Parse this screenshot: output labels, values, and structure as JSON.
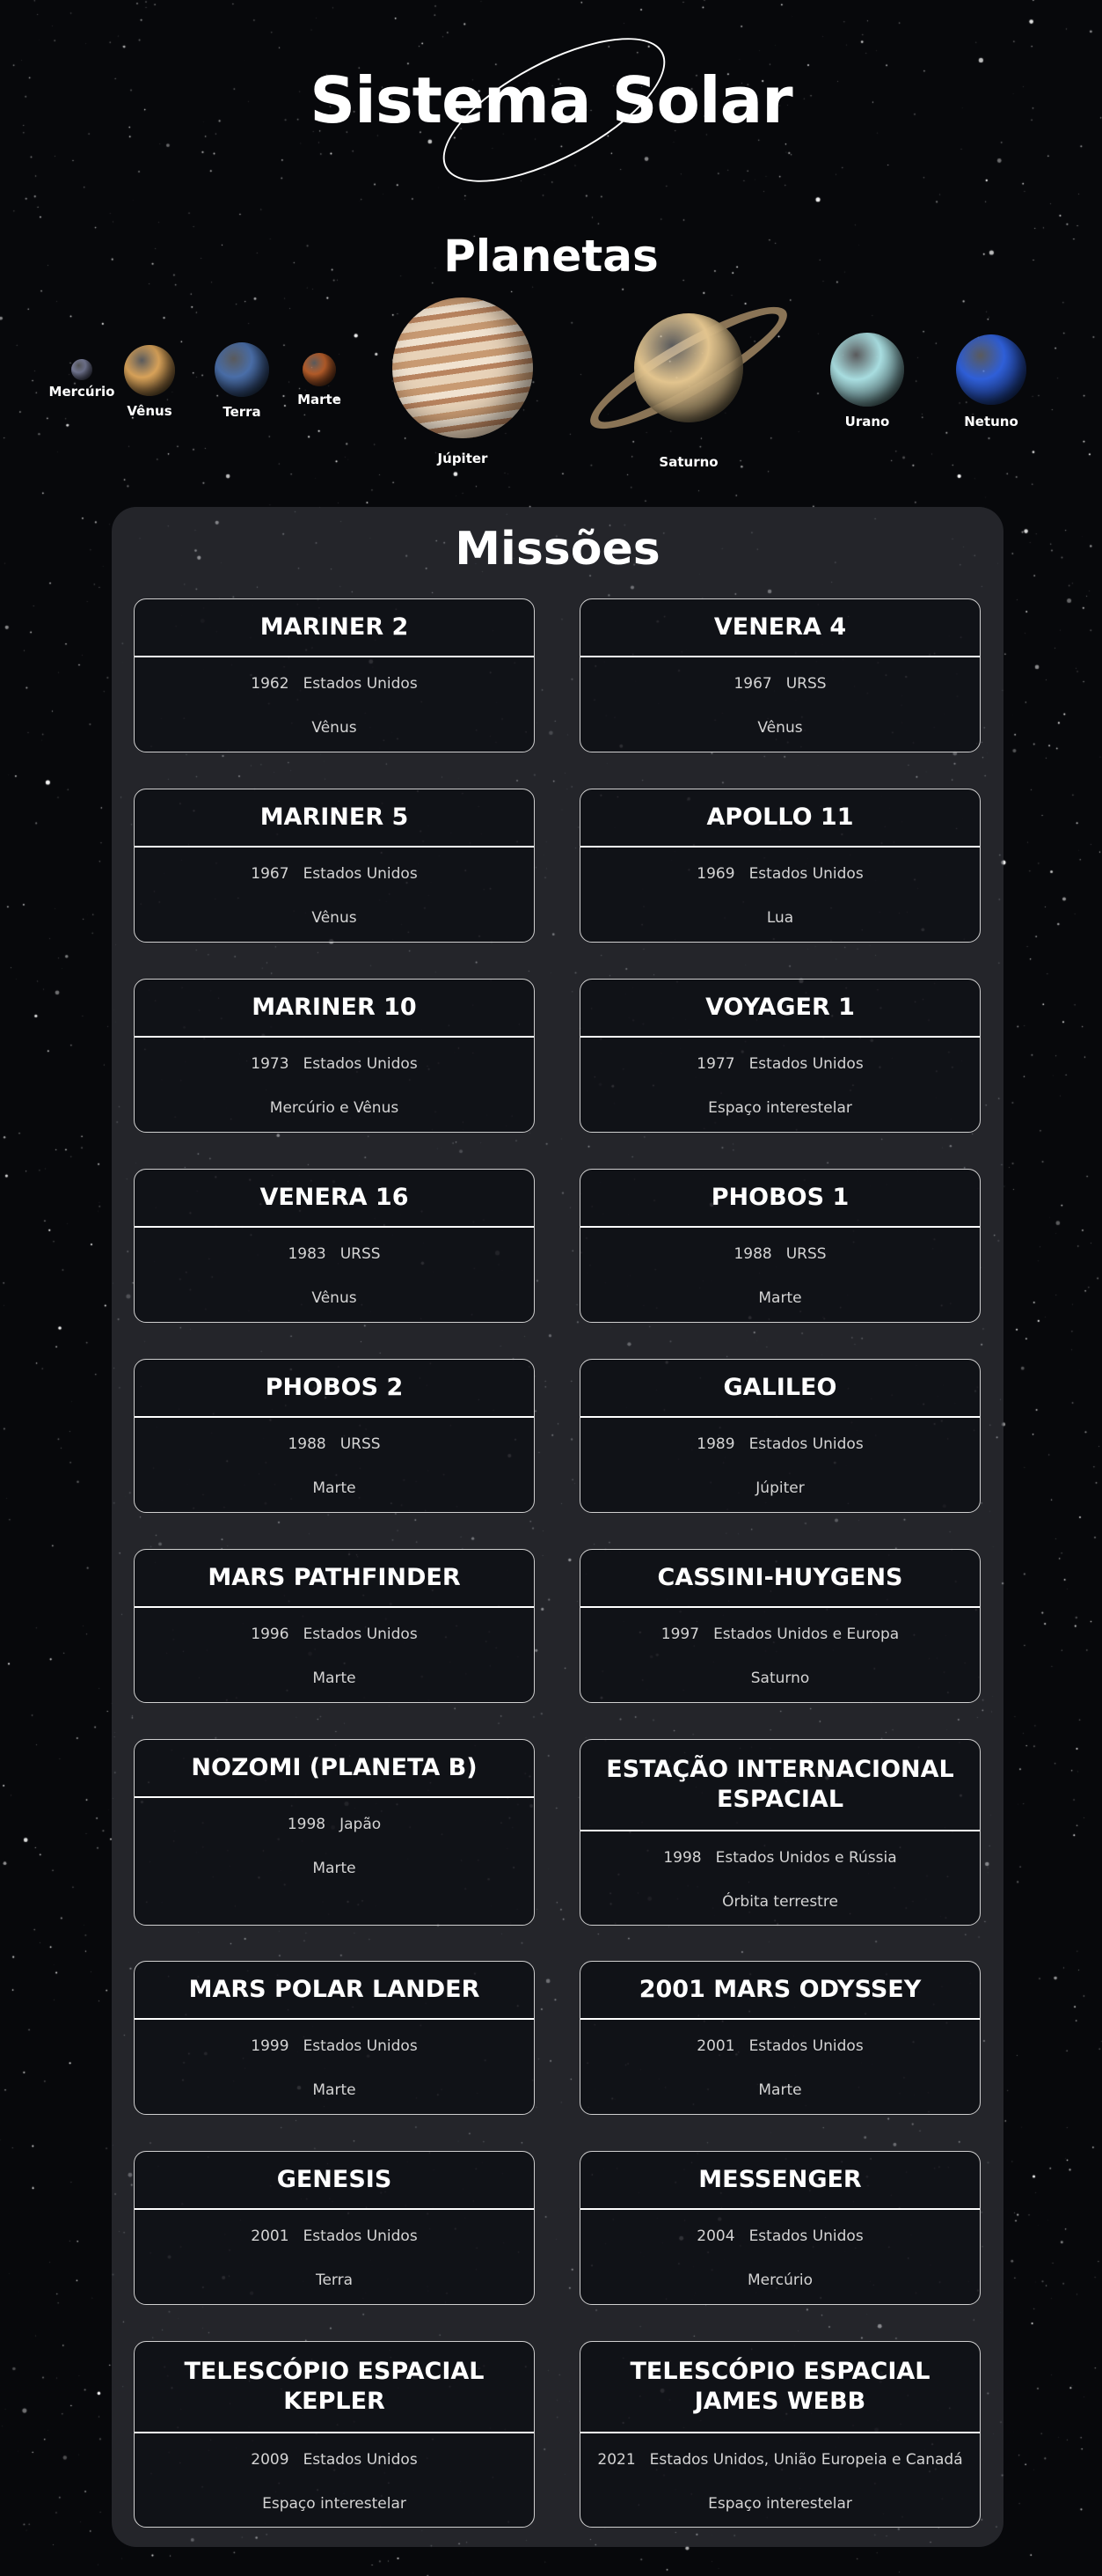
{
  "site_title": "Sistema Solar",
  "planets_title": "Planetas",
  "planets": [
    {
      "name": "Mercúrio",
      "color": "#8a8fb0"
    },
    {
      "name": "Vênus",
      "color": "#d9a35a"
    },
    {
      "name": "Terra",
      "color": "#4a6ea8"
    },
    {
      "name": "Marte",
      "color": "#c0622c"
    },
    {
      "name": "Júpiter",
      "color": "#d9b896"
    },
    {
      "name": "Saturno",
      "color": "#e2c48e"
    },
    {
      "name": "Urano",
      "color": "#a8dde0"
    },
    {
      "name": "Netuno",
      "color": "#2f5fd8"
    }
  ],
  "missions_title": "Missões",
  "missions": [
    {
      "name": "MARINER 2",
      "year": "1962",
      "country": "Estados Unidos",
      "target": "Vênus"
    },
    {
      "name": "VENERA 4",
      "year": "1967",
      "country": "URSS",
      "target": "Vênus"
    },
    {
      "name": "MARINER 5",
      "year": "1967",
      "country": "Estados Unidos",
      "target": "Vênus"
    },
    {
      "name": "APOLLO 11",
      "year": "1969",
      "country": "Estados Unidos",
      "target": "Lua"
    },
    {
      "name": "MARINER 10",
      "year": "1973",
      "country": "Estados Unidos",
      "target": "Mercúrio e Vênus"
    },
    {
      "name": "VOYAGER 1",
      "year": "1977",
      "country": "Estados Unidos",
      "target": "Espaço interestelar"
    },
    {
      "name": "VENERA 16",
      "year": "1983",
      "country": "URSS",
      "target": "Vênus"
    },
    {
      "name": "PHOBOS 1",
      "year": "1988",
      "country": "URSS",
      "target": "Marte"
    },
    {
      "name": "PHOBOS 2",
      "year": "1988",
      "country": "URSS",
      "target": "Marte"
    },
    {
      "name": "GALILEO",
      "year": "1989",
      "country": "Estados Unidos",
      "target": "Júpiter"
    },
    {
      "name": "MARS PATHFINDER",
      "year": "1996",
      "country": "Estados Unidos",
      "target": "Marte"
    },
    {
      "name": "CASSINI-HUYGENS",
      "year": "1997",
      "country": "Estados Unidos e Europa",
      "target": "Saturno"
    },
    {
      "name": "NOZOMI (PLANETA B)",
      "year": "1998",
      "country": "Japão",
      "target": "Marte"
    },
    {
      "name": "ESTAÇÃO INTERNACIONAL ESPACIAL",
      "year": "1998",
      "country": "Estados Unidos e Rússia",
      "target": "Órbita terrestre"
    },
    {
      "name": "MARS POLAR LANDER",
      "year": "1999",
      "country": "Estados Unidos",
      "target": "Marte"
    },
    {
      "name": "2001 MARS ODYSSEY",
      "year": "2001",
      "country": "Estados Unidos",
      "target": "Marte"
    },
    {
      "name": "GENESIS",
      "year": "2001",
      "country": "Estados Unidos",
      "target": "Terra"
    },
    {
      "name": "MESSENGER",
      "year": "2004",
      "country": "Estados Unidos",
      "target": "Mercúrio"
    },
    {
      "name": "TELESCÓPIO ESPACIAL KEPLER",
      "year": "2009",
      "country": "Estados Unidos",
      "target": "Espaço interestelar"
    },
    {
      "name": "TELESCÓPIO ESPACIAL JAMES WEBB",
      "year": "2021",
      "country": "Estados Unidos, União Europeia e Canadá",
      "target": "Espaço interestelar"
    }
  ]
}
